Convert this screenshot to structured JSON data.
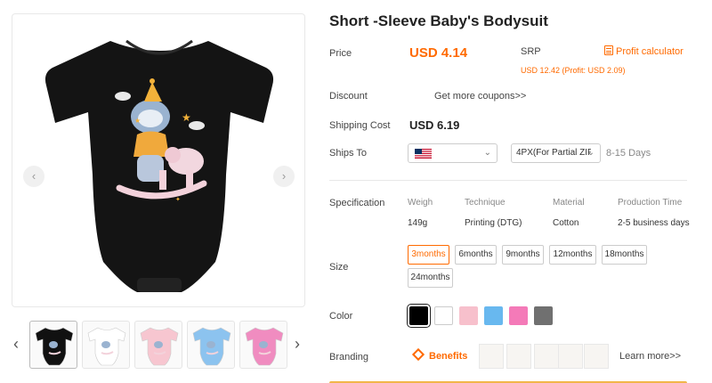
{
  "product": {
    "title": "Short -Sleeve Baby's Bodysuit",
    "image_alt_icon": "baby-bodysuit-image"
  },
  "gallery": {
    "prev_icon": "chevron-left-icon",
    "next_icon": "chevron-right-icon",
    "thumbnails": [
      {
        "color": "#111111",
        "name": "black"
      },
      {
        "color": "#ffffff",
        "name": "white"
      },
      {
        "color": "#f7c6d0",
        "name": "pink"
      },
      {
        "color": "#8cc3ef",
        "name": "blue"
      },
      {
        "color": "#f08cc0",
        "name": "rose"
      }
    ]
  },
  "price": {
    "label": "Price",
    "value": "USD 4.14",
    "srp_label": "SRP",
    "profit_calculator": "Profit calculator",
    "srp_line": "USD 12.42 (Profit: USD 2.09)"
  },
  "discount": {
    "label": "Discount",
    "link": "Get more coupons>>"
  },
  "shipping": {
    "cost_label": "Shipping Cost",
    "cost_value": "USD 6.19",
    "ships_to_label": "Ships To",
    "country_icon": "us-flag-icon",
    "shipper": "4PX(For Partial ZIP",
    "days": "8-15 Days"
  },
  "specification": {
    "label": "Specification",
    "headers": [
      "Weigh",
      "Technique",
      "Material",
      "Production Time"
    ],
    "values": [
      "149g",
      "Printing (DTG)",
      "Cotton",
      "2-5 business days"
    ]
  },
  "size": {
    "label": "Size",
    "options": [
      "3months",
      "6months",
      "9months",
      "12months",
      "18months",
      "24months"
    ],
    "selected": "3months"
  },
  "color": {
    "label": "Color",
    "swatches": [
      "#000000",
      "#ffffff",
      "#f7c0cc",
      "#68b8ef",
      "#f47ab8",
      "#707070"
    ],
    "selected": "#000000"
  },
  "branding": {
    "label": "Branding",
    "benefits": "Benefits",
    "learn_more": "Learn more>>"
  },
  "colors": {
    "accent": "#ff6a00"
  }
}
